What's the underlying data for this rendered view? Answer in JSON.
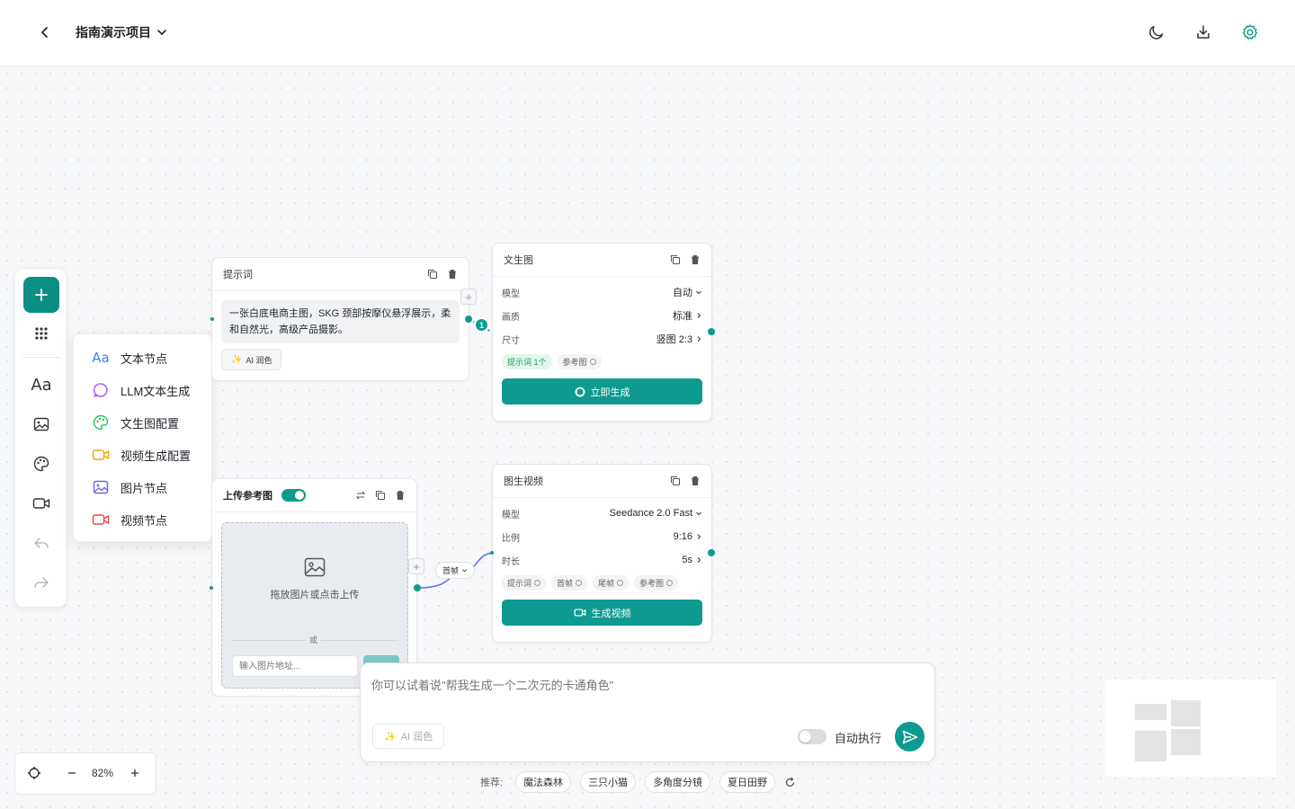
{
  "header": {
    "project_name": "指南演示项目"
  },
  "toolbar": {
    "items": [
      "add-icon",
      "grid-icon",
      "text-icon",
      "image-icon",
      "palette-icon",
      "video-icon",
      "undo-icon",
      "redo-icon"
    ]
  },
  "add_menu": {
    "items": [
      {
        "label": "文本节点",
        "icon": "text-aa-icon",
        "color": "#3b82f6"
      },
      {
        "label": "LLM文本生成",
        "icon": "chat-bubble-icon",
        "color": "#a855f7"
      },
      {
        "label": "文生图配置",
        "icon": "palette-icon",
        "color": "#22c55e"
      },
      {
        "label": "视频生成配置",
        "icon": "video-camera-icon",
        "color": "#f59e0b"
      },
      {
        "label": "图片节点",
        "icon": "image-icon",
        "color": "#6366f1"
      },
      {
        "label": "视频节点",
        "icon": "video-camera-icon",
        "color": "#ef4444"
      }
    ]
  },
  "prompt_node": {
    "title": "提示词",
    "text": "一张白底电商主图，SKG 颈部按摩仪悬浮展示，柔和自然光，高级产品摄影。",
    "ai_button": "AI 润色"
  },
  "t2i_node": {
    "title": "文生图",
    "rows": [
      {
        "label": "模型",
        "value": "自动"
      },
      {
        "label": "画质",
        "value": "标准"
      },
      {
        "label": "尺寸",
        "value": "竖图 2:3"
      }
    ],
    "chips": [
      "提示词 1个",
      "参考图"
    ],
    "button": "立即生成",
    "badge": "1"
  },
  "upload_node": {
    "title": "上传参考图",
    "toggle_on": true,
    "drop_text": "拖放图片或点击上传",
    "or_text": "或",
    "url_placeholder": "输入图片地址..."
  },
  "connector": {
    "label": "首帧"
  },
  "i2v_node": {
    "title": "图生视频",
    "rows": [
      {
        "label": "模型",
        "value": "Seedance 2.0 Fast"
      },
      {
        "label": "比例",
        "value": "9:16"
      },
      {
        "label": "时长",
        "value": "5s"
      }
    ],
    "chips": [
      "提示词",
      "首帧",
      "尾帧",
      "参考图"
    ],
    "button": "生成视频"
  },
  "chat": {
    "placeholder": "你可以试着说\"帮我生成一个二次元的卡通角色\"",
    "ai_button": "AI 润色",
    "auto_label": "自动执行",
    "auto_on": false
  },
  "suggestions": {
    "label": "推荐:",
    "items": [
      "魔法森林",
      "三只小猫",
      "多角度分镜",
      "夏日田野"
    ]
  },
  "zoom": {
    "level": "82%"
  },
  "colors": {
    "accent": "#0e9a90",
    "accent_dark": "#0b8f85"
  }
}
